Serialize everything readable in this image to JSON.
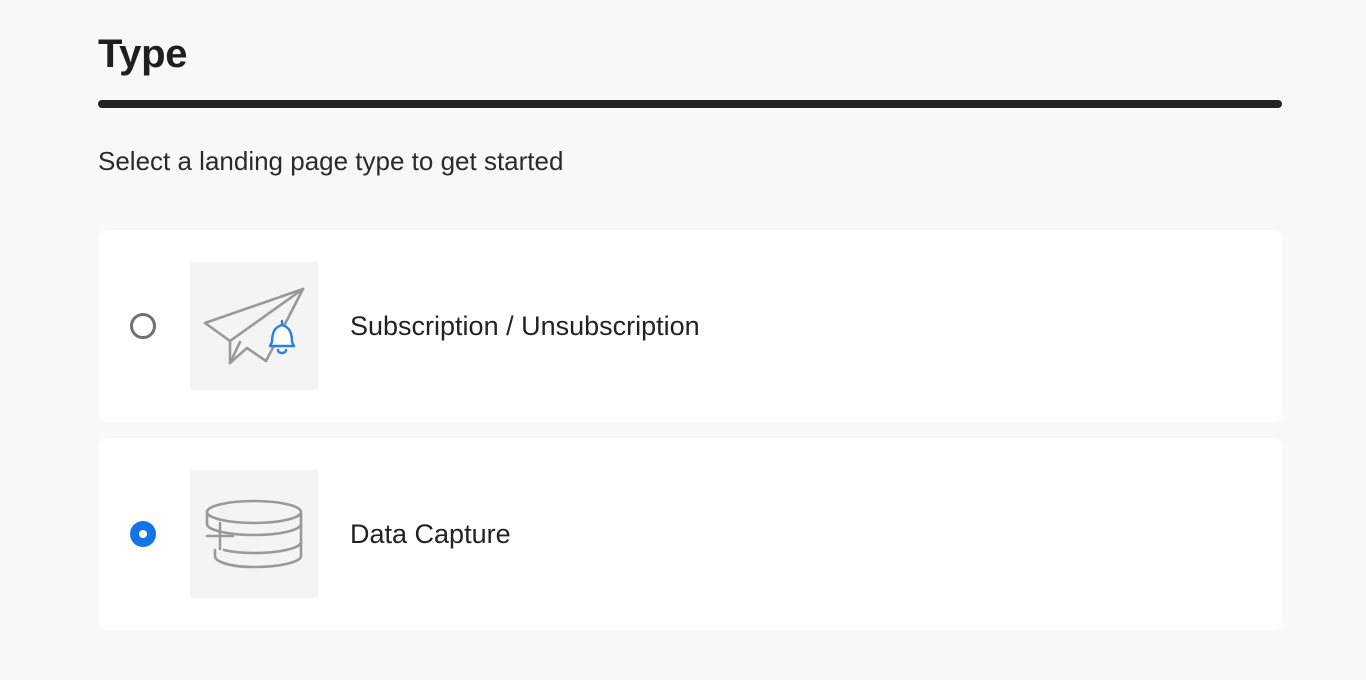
{
  "section": {
    "title": "Type",
    "subtitle": "Select a landing page type to get started"
  },
  "options": [
    {
      "label": "Subscription / Unsubscription",
      "selected": false,
      "icon": "paper-plane-bell-icon"
    },
    {
      "label": "Data Capture",
      "selected": true,
      "icon": "database-add-icon"
    }
  ],
  "colors": {
    "accent": "#1473e6",
    "icon_stroke": "#999999",
    "bell_stroke": "#2680eb",
    "radio_border": "#707070",
    "page_background": "#f8f8f8",
    "card_background": "#ffffff",
    "text": "#222222"
  }
}
